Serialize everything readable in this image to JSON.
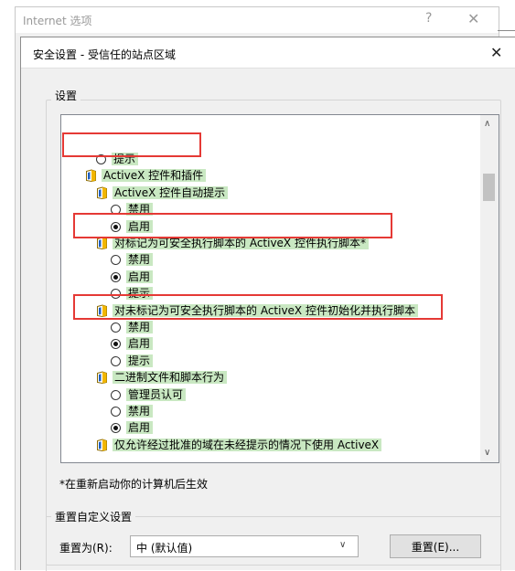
{
  "outer_window": {
    "title": "Internet 选项",
    "help_glyph": "?",
    "close_glyph": "✕"
  },
  "dialog": {
    "title": "安全设置 - 受信任的站点区域",
    "close_glyph": "✕",
    "settings_group_label": "设置",
    "tree_rows": [
      {
        "kind": "radio",
        "text": "提示",
        "checked": false,
        "indent": 1
      },
      {
        "kind": "folder",
        "text": "ActiveX 控件和插件",
        "indent": 0
      },
      {
        "kind": "folder",
        "text": "ActiveX 控件自动提示",
        "indent": 1
      },
      {
        "kind": "radio",
        "text": "禁用",
        "checked": false,
        "indent": 2
      },
      {
        "kind": "radio",
        "text": "启用",
        "checked": true,
        "indent": 2
      },
      {
        "kind": "folder",
        "text": "对标记为可安全执行脚本的 ActiveX 控件执行脚本*",
        "indent": 1
      },
      {
        "kind": "radio",
        "text": "禁用",
        "checked": false,
        "indent": 2
      },
      {
        "kind": "radio",
        "text": "启用",
        "checked": true,
        "indent": 2
      },
      {
        "kind": "radio",
        "text": "提示",
        "checked": false,
        "indent": 2
      },
      {
        "kind": "folder",
        "text": "对未标记为可安全执行脚本的 ActiveX 控件初始化并执行脚本",
        "indent": 1
      },
      {
        "kind": "radio",
        "text": "禁用",
        "checked": false,
        "indent": 2
      },
      {
        "kind": "radio",
        "text": "启用",
        "checked": true,
        "indent": 2
      },
      {
        "kind": "radio",
        "text": "提示",
        "checked": false,
        "indent": 2
      },
      {
        "kind": "folder",
        "text": "二进制文件和脚本行为",
        "indent": 1
      },
      {
        "kind": "radio",
        "text": "管理员认可",
        "checked": false,
        "indent": 2
      },
      {
        "kind": "radio",
        "text": "禁用",
        "checked": false,
        "indent": 2
      },
      {
        "kind": "radio",
        "text": "启用",
        "checked": true,
        "indent": 2
      },
      {
        "kind": "folder",
        "text": "仅允许经过批准的域在未经提示的情况下使用 ActiveX",
        "indent": 1
      }
    ],
    "scroll_up_glyph": "∧",
    "scroll_down_glyph": "∨",
    "restart_note": "*在重新启动你的计算机后生效",
    "reset_group_label": "重置自定义设置",
    "reset_to_label": "重置为(R):",
    "reset_to_value": "中 (默认值)",
    "reset_button_label": "重置(E)..."
  },
  "colors": {
    "row_highlight": "#c9e8c2",
    "annotation_red": "#e53935",
    "folder_icon": "#f2b600"
  }
}
